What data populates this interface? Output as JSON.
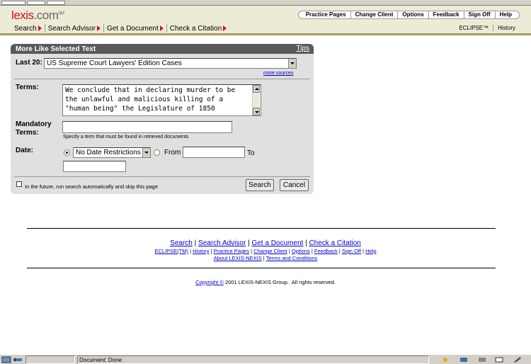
{
  "logo": {
    "name": "lexis",
    "dot": ".",
    "tld": "com",
    "tm": "SM"
  },
  "topnav": [
    "Practice Pages",
    "Change Client",
    "Options",
    "Feedback",
    "Sign Off",
    "Help"
  ],
  "mainnav": [
    "Search",
    "Search Advisor",
    "Get a Document",
    "Check a Citation"
  ],
  "rightnav": [
    "ECLIPSE™",
    "History"
  ],
  "panel": {
    "title": "More Like Selected Text",
    "tips": "Tips",
    "last20_label": "Last 20:",
    "source_value": "US Supreme Court Lawyers' Edition Cases",
    "more_sources": "more sources",
    "terms_label": "Terms:",
    "terms_lines": [
      "We conclude that in declaring murder to be",
      "the unlawful and malicious killing of a",
      "\"human being\" the Legislature of 1850"
    ],
    "mandatory_label_1": "Mandatory",
    "mandatory_label_2": "Terms:",
    "mandatory_value": "",
    "mandatory_hint": "Specify a term that must be found in retrieved documents",
    "date_label": "Date:",
    "date_option": "No Date Restrictions",
    "from_label": "From",
    "to_label": "To",
    "from_value": "",
    "to_value": "",
    "auto_label": "In the future, run search automatically and skip this page",
    "search_btn": "Search",
    "cancel_btn": "Cancel"
  },
  "footer": {
    "nav1": [
      "Search",
      "Search Advisor",
      "Get a Document",
      "Check a Citation"
    ],
    "nav2": [
      "ECLIPSE(TM)",
      "History",
      "Practice Pages",
      "Change Client",
      "Options",
      "Feedback",
      "Sign Off",
      "Help"
    ],
    "nav3": [
      "About LEXIS-NEXIS",
      "Terms and Conditions"
    ],
    "copyright_link": "Copyright ©",
    "copyright_text": " 2001 LEXIS-NEXIS Group.  All rights reserved."
  },
  "status": {
    "text": "Document: Done"
  }
}
